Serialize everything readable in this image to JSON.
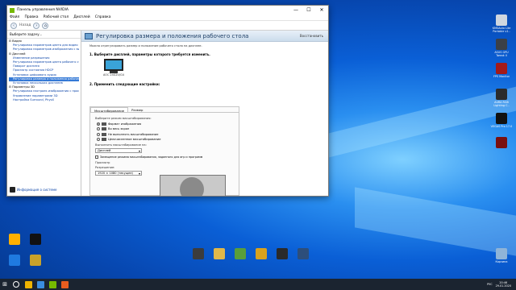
{
  "window": {
    "title": "Панель управления NVIDIA",
    "minimize": "—",
    "maximize": "☐",
    "close": "✕",
    "menu": [
      "Файл",
      "Правка",
      "Рабочий стол",
      "Дисплей",
      "Справка"
    ],
    "toolbar": {
      "back_label": "Назад"
    }
  },
  "sidebar": {
    "task_header": "Выберите задачу...",
    "tree": [
      {
        "type": "cat",
        "label": "⊟ Видео"
      },
      {
        "type": "item",
        "label": "Регулировка параметров цвета для видео"
      },
      {
        "type": "item",
        "label": "Регулировка параметров изображения с видео"
      },
      {
        "type": "cat",
        "label": "⊟ Дисплей"
      },
      {
        "type": "item",
        "label": "Изменение разрешения"
      },
      {
        "type": "item",
        "label": "Регулировка параметров цвета рабочего стола"
      },
      {
        "type": "item",
        "label": "Поворот дисплея"
      },
      {
        "type": "item",
        "label": "Просмотр состояния HDCP"
      },
      {
        "type": "item",
        "label": "Установка цифрового аудио"
      },
      {
        "type": "item",
        "label": "Регулировка размера и положения рабочего стола",
        "selected": true
      },
      {
        "type": "item",
        "label": "Установка нескольких дисплеев"
      },
      {
        "type": "cat",
        "label": "⊟ Параметры 3D"
      },
      {
        "type": "item",
        "label": "Регулировка настроек изображения с просмотром"
      },
      {
        "type": "item",
        "label": "Управление параметрами 3D"
      },
      {
        "type": "item",
        "label": "Настройка Surround, PhysX"
      }
    ],
    "system_info": "Информация о системе"
  },
  "main": {
    "title": "Регулировка размера и положения рабочего стола",
    "restore": "Восстановить",
    "description": "Можно отрегулировать размер и положение рабочего стола на дисплее.",
    "step1": "1. Выберите дисплей, параметры которого требуется изменить.",
    "monitor_label": "AOC 24G2U/G4",
    "step2": "2. Применить следующие настройки:",
    "tabs": [
      "Масштабирование",
      "Размер"
    ],
    "scaling_mode_label": "Выберите режим масштабирования:",
    "scaling_options": [
      {
        "label": "Формат изображения",
        "selected": true
      },
      {
        "label": "Во весь экран",
        "selected": false
      },
      {
        "label": "Не выполнять масштабирование",
        "selected": false
      },
      {
        "label": "Целочисленное масштабирование",
        "selected": false
      }
    ],
    "perform_on_label": "Выполнить масштабирование на:",
    "perform_on_value": "Дисплей",
    "override_checkbox": "Замещение режима масштабирования, заданного для игр и программ",
    "preview_label": "Просмотр",
    "resolution_label": "Разрешение:",
    "resolution_value": "1920 × 1080 (текущее)"
  },
  "desktop_icons": [
    {
      "label": "KMSAuto Lite Portable v1..",
      "color": "#cfd6df"
    },
    {
      "label": "ASUS GPU Tweak II",
      "color": "#3b4048"
    },
    {
      "label": "FPS Monitor",
      "color": "#a31a1a"
    },
    {
      "label": "AURA RGB Lighting C..",
      "color": "#2b2b2b"
    },
    {
      "label": "VEGAS Pro 17.0",
      "color": "#111111"
    },
    {
      "label": "",
      "color": "#7a1010"
    },
    {
      "label": "",
      "color": "#ffb000"
    },
    {
      "label": "",
      "color": "#111111"
    },
    {
      "label": "",
      "color": "#1f7ae0"
    },
    {
      "label": "",
      "color": "#c8a22a"
    },
    {
      "label": "",
      "color": "#3c3c3c"
    },
    {
      "label": "",
      "color": "#e0b84a"
    },
    {
      "label": "",
      "color": "#5a9e3a"
    },
    {
      "label": "",
      "color": "#d9a21e"
    },
    {
      "label": "",
      "color": "#2a2a2a"
    },
    {
      "label": "",
      "color": "#2d4e7a"
    },
    {
      "label": "Корзина",
      "color": "#8fb4d8"
    }
  ],
  "taskbar": {
    "apps": [
      "#f0b400",
      "#3a8de0",
      "#76b900",
      "#e85d1f"
    ],
    "tray": "РУС",
    "time": "20:46",
    "date": "29.01.2020"
  }
}
